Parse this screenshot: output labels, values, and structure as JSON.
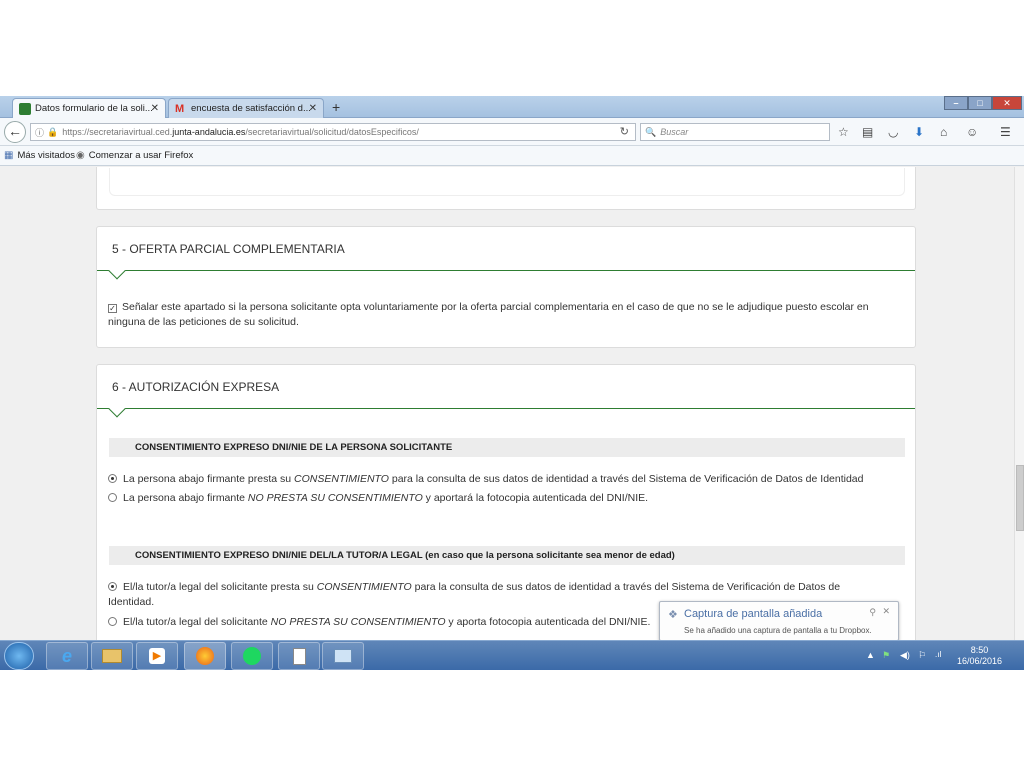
{
  "browser": {
    "tabs": [
      {
        "label": "Datos formulario de la soli...",
        "active": true
      },
      {
        "label": "encuesta de satisfacción d...",
        "active": false
      }
    ],
    "new_tab": "+",
    "url_prefix": "https://secretariavirtual.ced.",
    "url_host": "junta-andalucia.es",
    "url_path": "/secretariavirtual/solicitud/datosEspecificos/",
    "search_placeholder": "Buscar",
    "bookmarks": [
      "Más visitados",
      "Comenzar a usar Firefox"
    ]
  },
  "section5": {
    "title": "5 - OFERTA PARCIAL COMPLEMENTARIA",
    "checkbox_checked": true,
    "checkbox_text": "Señalar este apartado si la persona solicitante opta voluntariamente por la oferta parcial complementaria en el caso de que no se le adjudique puesto escolar en ninguna de las peticiones de su solicitud."
  },
  "section6": {
    "title": "6 - AUTORIZACIÓN EXPRESA",
    "group1": {
      "heading": "CONSENTIMIENTO EXPRESO DNI/NIE DE LA PERSONA SOLICITANTE",
      "opt1": {
        "a": "La persona abajo firmante presta su ",
        "em": "CONSENTIMIENTO",
        "b": " para la consulta de sus datos de identidad a través del Sistema de Verificación de Datos de Identidad"
      },
      "opt2": {
        "a": "La persona abajo firmante ",
        "em": "NO PRESTA SU CONSENTIMIENTO",
        "b": " y aportará la fotocopia autenticada del DNI/NIE."
      }
    },
    "group2": {
      "heading": "CONSENTIMIENTO EXPRESO DNI/NIE DEL/LA TUTOR/A LEGAL (en caso que la persona solicitante sea menor de edad)",
      "opt1": {
        "a": "El/la tutor/a legal del solicitante presta su ",
        "em": "CONSENTIMIENTO",
        "b": " para la consulta de sus datos de identidad a través del Sistema de Verificación de Datos de Identidad."
      },
      "opt2": {
        "a": "El/la tutor/a legal del solicitante ",
        "em": "NO PRESTA SU CONSENTIMIENTO",
        "b": " y aporta fotocopia autenticada del DNI/NIE."
      }
    }
  },
  "notification": {
    "title": "Captura de pantalla añadida",
    "message": "Se ha añadido una captura de pantalla a tu Dropbox."
  },
  "taskbar": {
    "time": "8:50",
    "date": "16/06/2016"
  }
}
